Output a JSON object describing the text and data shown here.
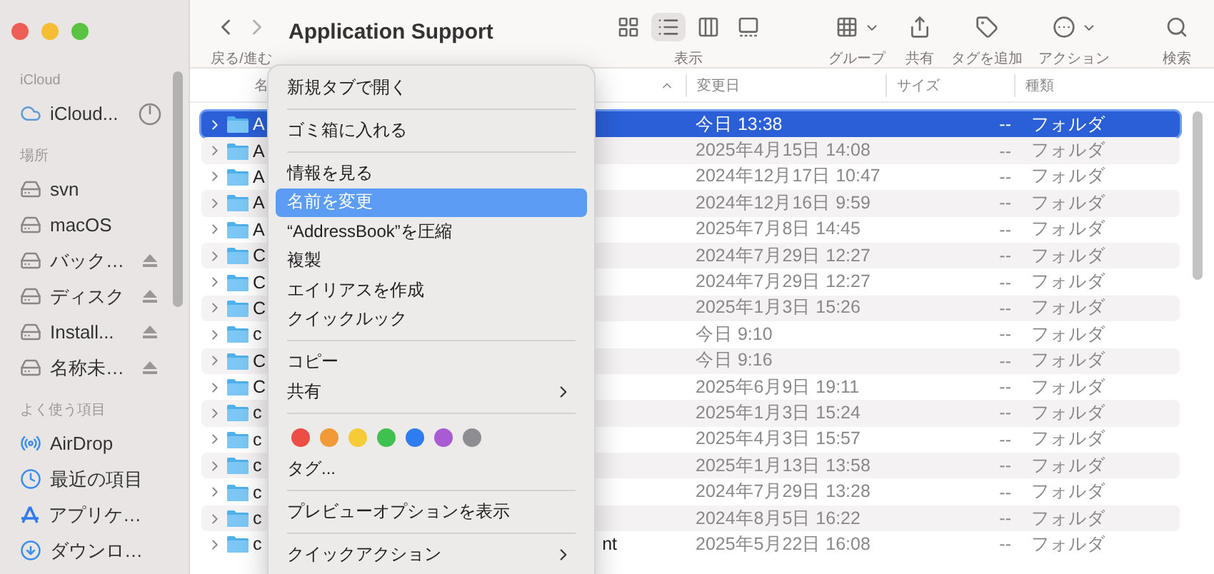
{
  "window": {
    "title": "Application Support"
  },
  "sidebar": {
    "sections": [
      {
        "label": "iCloud",
        "items": [
          {
            "kind": "cloud",
            "label": "iCloud...",
            "eject": false,
            "syncing": true
          }
        ]
      },
      {
        "label": "場所",
        "items": [
          {
            "kind": "drive",
            "label": "svn",
            "eject": false,
            "syncing": false
          },
          {
            "kind": "drive",
            "label": "macOS",
            "eject": false,
            "syncing": false
          },
          {
            "kind": "drive",
            "label": "バック…",
            "eject": true,
            "syncing": false
          },
          {
            "kind": "drive",
            "label": "ディスク",
            "eject": true,
            "syncing": false
          },
          {
            "kind": "drive",
            "label": "Install...",
            "eject": true,
            "syncing": false
          },
          {
            "kind": "drive",
            "label": "名称未…",
            "eject": true,
            "syncing": false
          }
        ]
      },
      {
        "label": "よく使う項目",
        "items": [
          {
            "kind": "airdrop",
            "label": "AirDrop",
            "eject": false,
            "syncing": false
          },
          {
            "kind": "recent",
            "label": "最近の項目",
            "eject": false,
            "syncing": false
          },
          {
            "kind": "apps",
            "label": "アプリケ…",
            "eject": false,
            "syncing": false
          },
          {
            "kind": "downloads",
            "label": "ダウンロ…",
            "eject": false,
            "syncing": false
          }
        ]
      }
    ]
  },
  "toolbar": {
    "nav_label": "戻る/進む",
    "views": [
      {
        "kind": "icons",
        "selected": false
      },
      {
        "kind": "list",
        "selected": true
      },
      {
        "kind": "columns",
        "selected": false
      },
      {
        "kind": "gallery",
        "selected": false
      }
    ],
    "views_label": "表示",
    "actions": [
      {
        "kind": "group",
        "label": "グループ"
      },
      {
        "kind": "share",
        "label": "共有"
      },
      {
        "kind": "tag",
        "label": "タグを追加"
      },
      {
        "kind": "action",
        "label": "アクション"
      },
      {
        "kind": "search",
        "label": "検索"
      }
    ]
  },
  "table": {
    "columns": [
      {
        "label": "名",
        "sorted": true
      },
      {
        "label": "変更日",
        "sorted": false
      },
      {
        "label": "サイズ",
        "sorted": false
      },
      {
        "label": "種類",
        "sorted": false
      }
    ],
    "rows": [
      {
        "name": "A",
        "date": "今日 13:38",
        "size": "--",
        "kind": "フォルダ",
        "selected": true
      },
      {
        "name": "A",
        "date": "2025年4月15日 14:08",
        "size": "--",
        "kind": "フォルダ",
        "selected": false
      },
      {
        "name": "A",
        "date": "2024年12月17日 10:47",
        "size": "--",
        "kind": "フォルダ",
        "selected": false
      },
      {
        "name": "A",
        "date": "2024年12月16日 9:59",
        "size": "--",
        "kind": "フォルダ",
        "selected": false
      },
      {
        "name": "A",
        "date": "2025年7月8日 14:45",
        "size": "--",
        "kind": "フォルダ",
        "selected": false
      },
      {
        "name": "C",
        "date": "2024年7月29日 12:27",
        "size": "--",
        "kind": "フォルダ",
        "selected": false
      },
      {
        "name": "C",
        "date": "2024年7月29日 12:27",
        "size": "--",
        "kind": "フォルダ",
        "selected": false
      },
      {
        "name": "C",
        "date": "2025年1月3日 15:26",
        "size": "--",
        "kind": "フォルダ",
        "selected": false
      },
      {
        "name": "c",
        "date": "今日 9:10",
        "size": "--",
        "kind": "フォルダ",
        "selected": false
      },
      {
        "name": "C",
        "date": "今日 9:16",
        "size": "--",
        "kind": "フォルダ",
        "selected": false
      },
      {
        "name": "C",
        "date": "2025年6月9日 19:11",
        "size": "--",
        "kind": "フォルダ",
        "selected": false
      },
      {
        "name": "c",
        "date": "2025年1月3日 15:24",
        "size": "--",
        "kind": "フォルダ",
        "selected": false
      },
      {
        "name": "c",
        "date": "2025年4月3日 15:57",
        "size": "--",
        "kind": "フォルダ",
        "selected": false
      },
      {
        "name": "c",
        "date": "2025年1月13日 13:58",
        "size": "--",
        "kind": "フォルダ",
        "selected": false
      },
      {
        "name": "c",
        "date": "2024年7月29日 13:28",
        "size": "--",
        "kind": "フォルダ",
        "selected": false
      },
      {
        "name": "c",
        "date": "2024年8月5日 16:22",
        "size": "--",
        "kind": "フォルダ",
        "selected": false
      },
      {
        "name": "c",
        "name_end": "nt",
        "date": "2025年5月22日 16:08",
        "size": "--",
        "kind": "フォルダ",
        "selected": false
      }
    ]
  },
  "context_menu": {
    "items": [
      {
        "kind": "item",
        "label": "新規タブで開く",
        "selected": false,
        "submenu": false
      },
      {
        "kind": "separator"
      },
      {
        "kind": "item",
        "label": "ゴミ箱に入れる",
        "selected": false,
        "submenu": false
      },
      {
        "kind": "separator"
      },
      {
        "kind": "item",
        "label": "情報を見る",
        "selected": false,
        "submenu": false
      },
      {
        "kind": "item",
        "label": "名前を変更",
        "selected": true,
        "submenu": false
      },
      {
        "kind": "item",
        "label": "“AddressBook”を圧縮",
        "selected": false,
        "submenu": false
      },
      {
        "kind": "item",
        "label": "複製",
        "selected": false,
        "submenu": false
      },
      {
        "kind": "item",
        "label": "エイリアスを作成",
        "selected": false,
        "submenu": false
      },
      {
        "kind": "item",
        "label": "クイックルック",
        "selected": false,
        "submenu": false
      },
      {
        "kind": "separator"
      },
      {
        "kind": "item",
        "label": "コピー",
        "selected": false,
        "submenu": false
      },
      {
        "kind": "item",
        "label": "共有",
        "selected": false,
        "submenu": true
      },
      {
        "kind": "separator"
      },
      {
        "kind": "colors",
        "colors": [
          {
            "color": "#ec4d46"
          },
          {
            "color": "#f19a37"
          },
          {
            "color": "#f5cb38"
          },
          {
            "color": "#3fc14f"
          },
          {
            "color": "#2f7bf0"
          },
          {
            "color": "#a85bd3"
          },
          {
            "color": "#8e8e92"
          }
        ]
      },
      {
        "kind": "item",
        "label": "タグ...",
        "selected": false,
        "submenu": false
      },
      {
        "kind": "separator"
      },
      {
        "kind": "item",
        "label": "プレビューオプションを表示",
        "selected": false,
        "submenu": false
      },
      {
        "kind": "separator"
      },
      {
        "kind": "item",
        "label": "クイックアクション",
        "selected": false,
        "submenu": true
      }
    ]
  }
}
